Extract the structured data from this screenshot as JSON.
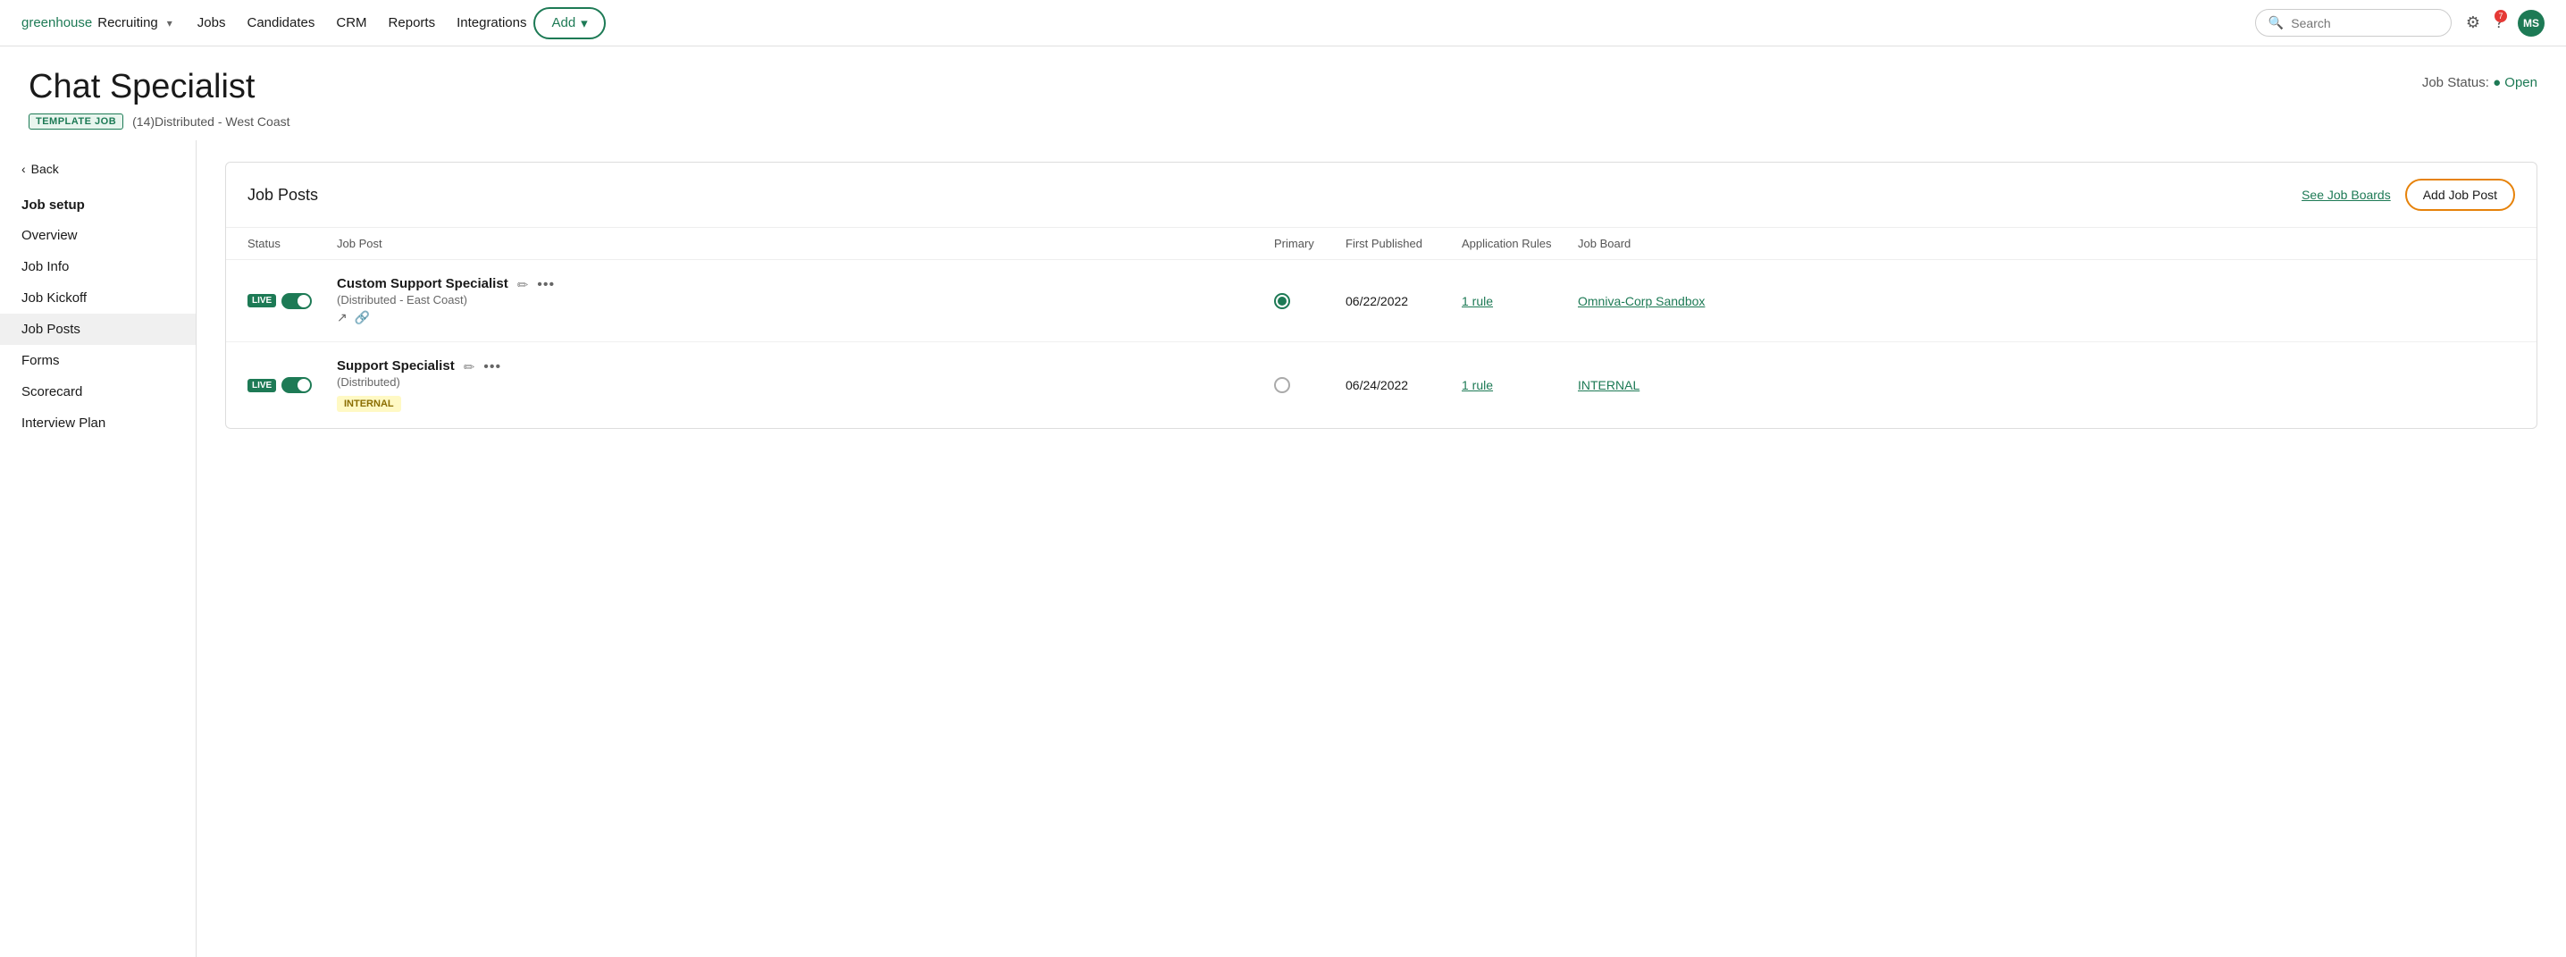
{
  "nav": {
    "logo_green": "greenhouse",
    "logo_text": "Recruiting",
    "links": [
      "Jobs",
      "Candidates",
      "CRM",
      "Reports",
      "Integrations"
    ],
    "add_label": "Add",
    "search_placeholder": "Search",
    "notif_count": "7",
    "avatar_initials": "MS"
  },
  "page": {
    "title": "Chat Specialist",
    "template_badge": "TEMPLATE JOB",
    "location": "(14)Distributed - West Coast",
    "job_status_label": "Job Status:",
    "job_status_value": "Open"
  },
  "sidebar": {
    "back_label": "Back",
    "section_title": "Job setup",
    "items": [
      {
        "label": "Overview",
        "active": false
      },
      {
        "label": "Job Info",
        "active": false
      },
      {
        "label": "Job Kickoff",
        "active": false
      },
      {
        "label": "Job Posts",
        "active": true
      },
      {
        "label": "Forms",
        "active": false
      },
      {
        "label": "Scorecard",
        "active": false
      },
      {
        "label": "Interview Plan",
        "active": false
      }
    ]
  },
  "panel": {
    "title": "Job Posts",
    "see_job_boards_label": "See Job Boards",
    "add_job_post_label": "Add Job Post",
    "columns": [
      "Status",
      "Job Post",
      "Primary",
      "First Published",
      "Application Rules",
      "Job Board"
    ],
    "rows": [
      {
        "status_label": "LIVE",
        "name": "Custom Support Specialist",
        "location": "(Distributed - East Coast)",
        "has_external_link": true,
        "has_link_icon": true,
        "primary": true,
        "first_published": "06/22/2022",
        "rules": "1 rule",
        "job_board": "Omniva-Corp Sandbox",
        "internal_badge": null
      },
      {
        "status_label": "LIVE",
        "name": "Support Specialist",
        "location": "(Distributed)",
        "has_external_link": false,
        "has_link_icon": false,
        "primary": false,
        "first_published": "06/24/2022",
        "rules": "1 rule",
        "job_board": "INTERNAL",
        "internal_badge": "INTERNAL"
      }
    ]
  }
}
